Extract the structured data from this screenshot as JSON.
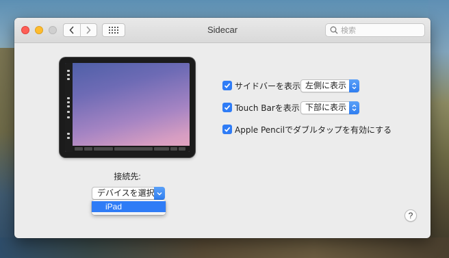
{
  "window": {
    "title": "Sidecar"
  },
  "search": {
    "placeholder": "検索"
  },
  "connection": {
    "label": "接続先:",
    "selected": "デバイスを選択",
    "menu_items": [
      "iPad"
    ]
  },
  "options": {
    "sidebar": {
      "label": "サイドバーを表示",
      "checked": true,
      "value": "左側に表示"
    },
    "touchbar": {
      "label": "Touch Barを表示",
      "checked": true,
      "value": "下部に表示"
    },
    "pencil": {
      "label": "Apple Pencilでダブルタップを有効にする",
      "checked": true
    }
  },
  "help": {
    "label": "?"
  },
  "colors": {
    "accent": "#2f7cf6",
    "close": "#fe5f57",
    "minimize": "#febc2e"
  }
}
